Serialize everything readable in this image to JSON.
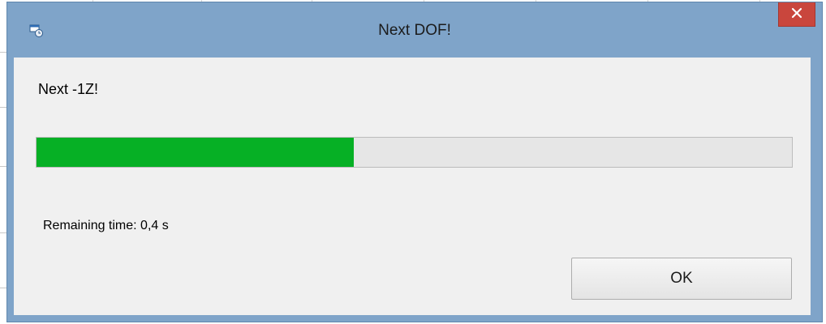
{
  "window": {
    "title": "Next DOF!",
    "icon": "app-window-icon",
    "close_icon": "close-icon"
  },
  "dialog": {
    "message": "Next -1Z!",
    "progress_fraction": 0.42,
    "remaining_text": "Remaining time: 0,4 s",
    "ok_label": "OK"
  },
  "colors": {
    "titlebar": "#7fa4c9",
    "close_button": "#c9463d",
    "progress_fill": "#06b025",
    "progress_track": "#e6e6e6",
    "client_background": "#f0f0f0"
  }
}
